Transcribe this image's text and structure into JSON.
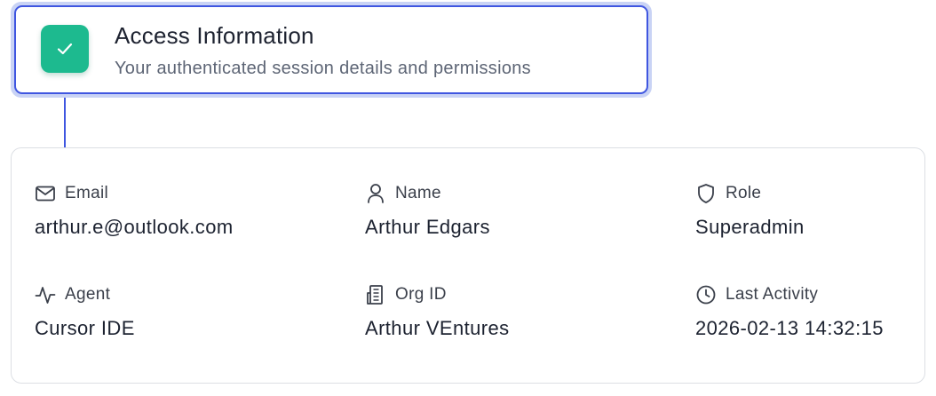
{
  "header": {
    "title": "Access Information",
    "subtitle": "Your authenticated session details and permissions",
    "status_icon": "check-icon",
    "accent_color": "#3f56e0",
    "status_color": "#1dba8f"
  },
  "fields": [
    {
      "key": "email",
      "icon": "mail-icon",
      "label": "Email",
      "value": "arthur.e@outlook.com"
    },
    {
      "key": "name",
      "icon": "user-icon",
      "label": "Name",
      "value": "Arthur Edgars"
    },
    {
      "key": "role",
      "icon": "shield-icon",
      "label": "Role",
      "value": "Superadmin"
    },
    {
      "key": "agent",
      "icon": "activity-icon",
      "label": "Agent",
      "value": "Cursor IDE"
    },
    {
      "key": "org_id",
      "icon": "building-icon",
      "label": "Org ID",
      "value": "Arthur VEntures"
    },
    {
      "key": "last_activity",
      "icon": "clock-icon",
      "label": "Last Activity",
      "value": "2026-02-13 14:32:15"
    }
  ]
}
